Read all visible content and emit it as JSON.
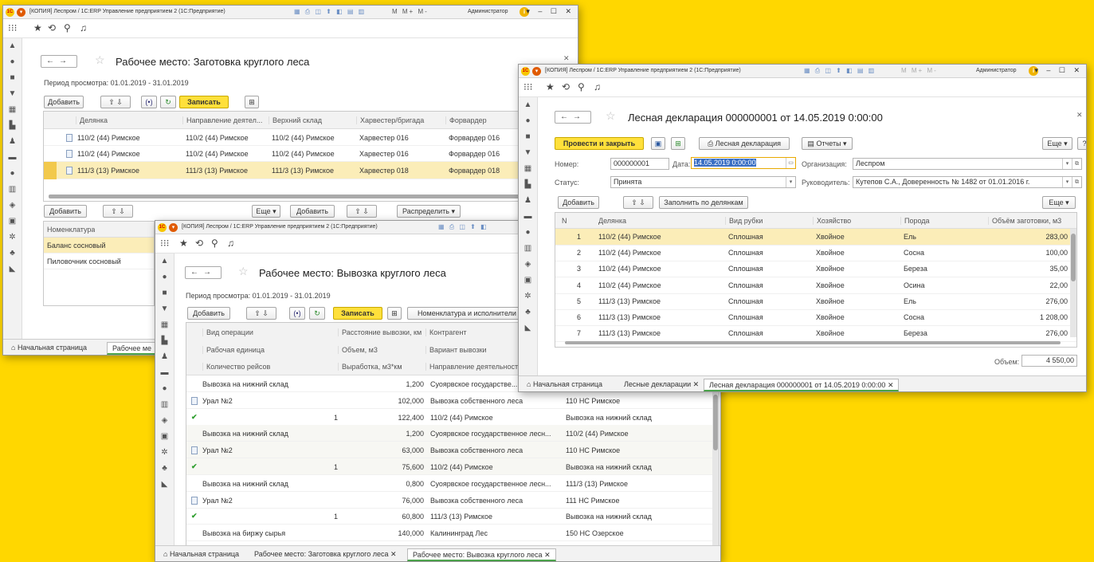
{
  "app": {
    "title": "[КОПИЯ] Леспром / 1С:ERP Управление предприятием 2  (1С:Предприятие)",
    "admin": "Администратор",
    "memtools": "M  M+  M-"
  },
  "w1": {
    "title": "Рабочее место: Заготовка круглого леса",
    "period": "Период просмотра: 01.01.2019 - 31.01.2019",
    "add": "Добавить",
    "save": "Записать",
    "cols": [
      "Делянка",
      "Направление деятел...",
      "Верхний склад",
      "Харвестер/бригада",
      "Форвардер"
    ],
    "rows": [
      [
        "110/2 (44) Римское",
        "110/2 (44) Римское",
        "110/2 (44) Римское",
        "Харвестер 016",
        "Форвардер 016"
      ],
      [
        "110/2 (44) Римское",
        "110/2 (44) Римское",
        "110/2 (44) Римское",
        "Харвестер 016",
        "Форвардер 016"
      ],
      [
        "111/3 (13) Римское",
        "111/3 (13) Римское",
        "111/3 (13) Римское",
        "Харвестер 018",
        "Форвардер 018"
      ]
    ],
    "add2": "Добавить",
    "more": "Еще",
    "add3": "Добавить",
    "distribute": "Распределить",
    "nomen_header": "Номенклатура",
    "nomen": [
      "Баланс сосновый",
      "Пиловочник сосновый"
    ],
    "tabs": [
      "Начальная страница",
      "Рабочее ме"
    ]
  },
  "w2": {
    "title": "Рабочее место: Вывозка круглого леса",
    "period": "Период просмотра: 01.01.2019 - 31.01.2019",
    "add": "Добавить",
    "save": "Записать",
    "nomen_btn": "Номенклатура и исполнители",
    "h1": [
      "Вид операции",
      "Расстояние вывозки, км",
      "Контрагент"
    ],
    "h2": [
      "Рабочая единица",
      "Объем, м3",
      "Вариант вывозки"
    ],
    "h3": [
      "Количество рейсов",
      "Выработка, м3*км",
      "Направление деятельности"
    ],
    "rows": [
      [
        "Вывозка на нижний склад",
        "",
        "1,200",
        "Суоярвское государстве...",
        ""
      ],
      [
        "Урал №2",
        "",
        "102,000",
        "Вывозка собственного леса",
        "110 НС Римское"
      ],
      [
        "",
        "1",
        "122,400",
        "110/2 (44) Римское",
        "Вывозка на нижний склад"
      ],
      [
        "Вывозка на нижний склад",
        "",
        "1,200",
        "Суоярвское государственное лесн...",
        "110/2 (44) Римское"
      ],
      [
        "Урал №2",
        "",
        "63,000",
        "Вывозка собственного леса",
        "110 НС Римское"
      ],
      [
        "",
        "1",
        "75,600",
        "110/2 (44) Римское",
        "Вывозка на нижний склад"
      ],
      [
        "Вывозка на нижний склад",
        "",
        "0,800",
        "Суоярвское государственное лесн...",
        "111/3 (13) Римское"
      ],
      [
        "Урал №2",
        "",
        "76,000",
        "Вывозка собственного леса",
        "111 НС Римское"
      ],
      [
        "",
        "1",
        "60,800",
        "111/3 (13) Римское",
        "Вывозка на нижний склад"
      ],
      [
        "Вывозка на биржу сырья",
        "",
        "140,000",
        "Калининград Лес",
        "150 НС Озерское"
      ]
    ],
    "tabs": [
      "Начальная страница",
      "Рабочее место: Заготовка круглого леса",
      "Рабочее место: Вывозка круглого леса"
    ]
  },
  "w3": {
    "title": "Лесная декларация 000000001 от 14.05.2019 0:00:00",
    "post_close": "Провести и закрыть",
    "decl_btn": "Лесная декларация",
    "reports": "Отчеты",
    "more": "Еще",
    "help": "?",
    "num_label": "Номер:",
    "num": "000000001",
    "date_label": "Дата:",
    "date": "14.05.2019  0:00:00",
    "org_label": "Организация:",
    "org": "Леспром",
    "status_label": "Статус:",
    "status": "Принята",
    "head_label": "Руководитель:",
    "head": "Кутепов С.А., Доверенность № 1482 от 01.01.2016 г.",
    "add": "Добавить",
    "fill": "Заполнить по делянкам",
    "more2": "Еще",
    "cols": [
      "N",
      "Делянка",
      "Вид рубки",
      "Хозяйство",
      "Порода",
      "Объём заготовки, м3"
    ],
    "rows": [
      [
        "1",
        "110/2 (44) Римское",
        "Сплошная",
        "Хвойное",
        "Ель",
        "283,00"
      ],
      [
        "2",
        "110/2 (44) Римское",
        "Сплошная",
        "Хвойное",
        "Сосна",
        "100,00"
      ],
      [
        "3",
        "110/2 (44) Римское",
        "Сплошная",
        "Хвойное",
        "Береза",
        "35,00"
      ],
      [
        "4",
        "110/2 (44) Римское",
        "Сплошная",
        "Хвойное",
        "Осина",
        "22,00"
      ],
      [
        "5",
        "111/3 (13) Римское",
        "Сплошная",
        "Хвойное",
        "Ель",
        "276,00"
      ],
      [
        "6",
        "111/3 (13) Римское",
        "Сплошная",
        "Хвойное",
        "Сосна",
        "1 208,00"
      ],
      [
        "7",
        "111/3 (13) Римское",
        "Сплошная",
        "Хвойное",
        "Береза",
        "276,00"
      ]
    ],
    "vol_label": "Объем:",
    "vol": "4 550,00",
    "tabs": [
      "Начальная страница",
      "Лесные декларации",
      "Лесная декларация 000000001 от 14.05.2019 0:00:00"
    ]
  }
}
